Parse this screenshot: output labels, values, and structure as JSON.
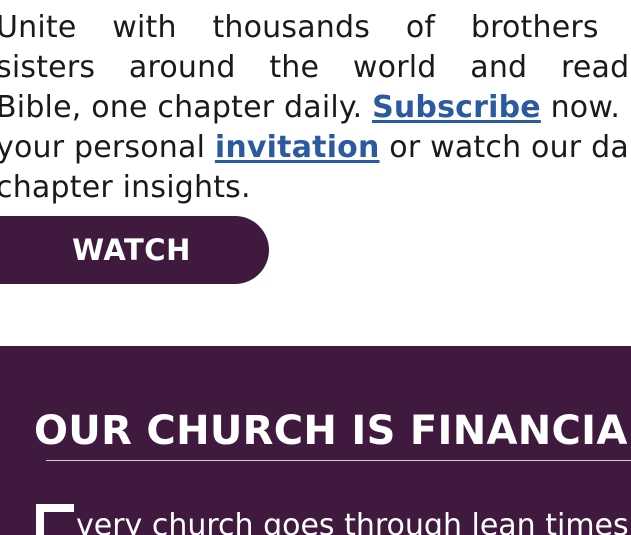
{
  "intro": {
    "line1": "Unite with thousands of brothers and",
    "line2": "sisters around the world and read the",
    "line3_before": "Bible, one chapter daily. ",
    "subscribe_link": "Subscribe",
    "line3_after": " now. Get",
    "line4_before": "your personal ",
    "invitation_link": "invitation",
    "line4_after": " or watch our daily",
    "line5": "chapter insights."
  },
  "watch_button": {
    "label": "WATCH"
  },
  "finance_section": {
    "title": "OUR CHURCH IS FINANCIALLY",
    "body": "very church goes through lean times"
  },
  "colors": {
    "brand_purple": "#401a3e",
    "link_blue": "#2b5aa0"
  }
}
